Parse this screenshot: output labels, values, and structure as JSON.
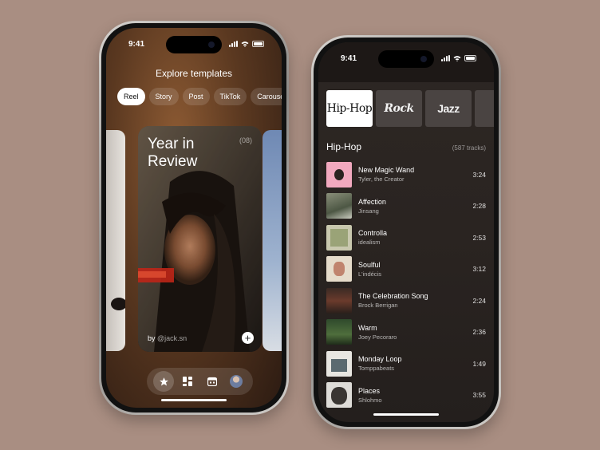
{
  "phone1": {
    "status_time": "9:41",
    "title": "Explore templates",
    "chips": [
      "Reel",
      "Story",
      "Post",
      "TikTok",
      "Carousel"
    ],
    "card": {
      "title": "Year in Review",
      "count": "(08)",
      "author_prefix": "by ",
      "author_handle": "@jack.sn"
    },
    "tabbar": [
      "star-icon",
      "grid-icon",
      "calendar-icon",
      "avatar"
    ]
  },
  "phone2": {
    "status_time": "9:41",
    "genres": [
      "Hip-Hop",
      "Rock",
      "Jazz"
    ],
    "list_title": "Hip-Hop",
    "list_count": "(587 tracks)",
    "tracks": [
      {
        "name": "New Magic Wand",
        "artist": "Tyler, the Creator",
        "duration": "3:24"
      },
      {
        "name": "Affection",
        "artist": "Jinsang",
        "duration": "2:28"
      },
      {
        "name": "Controlla",
        "artist": "idealism",
        "duration": "2:53"
      },
      {
        "name": "Soulful",
        "artist": "L'indécis",
        "duration": "3:12"
      },
      {
        "name": "The Celebration Song",
        "artist": "Brock Berrigan",
        "duration": "2:24"
      },
      {
        "name": "Warm",
        "artist": "Joey Pecoraro",
        "duration": "2:36"
      },
      {
        "name": "Monday Loop",
        "artist": "Tomppabeats",
        "duration": "1:49"
      },
      {
        "name": "Places",
        "artist": "Shlohmo",
        "duration": "3:55"
      }
    ]
  },
  "colors": {
    "background": "#a98e82",
    "accent_active_chip": "#ffffff"
  }
}
